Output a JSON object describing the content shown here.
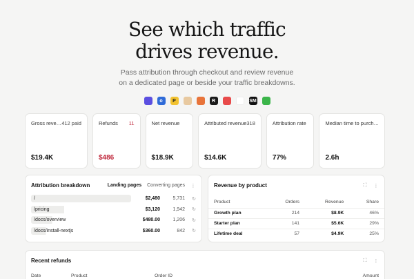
{
  "hero": {
    "title_line1": "See which traffic",
    "title_line2": "drives revenue.",
    "subtitle_line1": "Pass attribution through checkout and review revenue",
    "subtitle_line2": "on a dedicated page or beside your traffic breakdowns."
  },
  "logos": [
    {
      "name": "brand-logo-1",
      "glyph": "",
      "color": "#5b4fe0"
    },
    {
      "name": "brand-logo-2",
      "glyph": "o",
      "color": "#2f6bd8"
    },
    {
      "name": "brand-logo-3",
      "glyph": "P",
      "color": "#f2c230"
    },
    {
      "name": "brand-logo-4",
      "glyph": "",
      "color": "#e8c9a0"
    },
    {
      "name": "brand-logo-5",
      "glyph": "",
      "color": "#e8743a"
    },
    {
      "name": "brand-logo-6",
      "glyph": "R",
      "color": "#1a1a1a"
    },
    {
      "name": "brand-logo-7",
      "glyph": "",
      "color": "#e84a4a"
    },
    {
      "name": "brand-logo-8",
      "glyph": "",
      "color": "#ffffff"
    },
    {
      "name": "brand-logo-9",
      "glyph": "SM",
      "color": "#111111"
    },
    {
      "name": "brand-logo-10",
      "glyph": "",
      "color": "#3bb54a"
    }
  ],
  "stats": {
    "gross_revenue": {
      "label": "Gross reve…",
      "count": "412 paid",
      "value": "$19.4K"
    },
    "refunds": {
      "label": "Refunds",
      "count": "11",
      "value": "$486"
    },
    "net_revenue": {
      "label": "Net revenue",
      "count": "",
      "value": "$18.9K"
    },
    "attributed_revenue": {
      "label": "Attributed revenue",
      "count": "318",
      "value": "$14.6K"
    },
    "attribution_rate": {
      "label": "Attribution rate",
      "count": "",
      "value": "77%"
    },
    "median_time": {
      "label": "Median time to purch…",
      "count": "",
      "value": "2.6h"
    }
  },
  "attribution": {
    "title": "Attribution breakdown",
    "tab_landing": "Landing pages",
    "tab_converting": "Converting pages",
    "rows": [
      {
        "path": "/",
        "revenue": "$2,480",
        "orders": "5,731",
        "bar": 1.0
      },
      {
        "path": "/pricing",
        "revenue": "$3,120",
        "orders": "1,942",
        "bar": 0.33
      },
      {
        "path": "/docs/overview",
        "revenue": "$480.00",
        "orders": "1,206",
        "bar": 0.21
      },
      {
        "path": "/docs/install-nextjs",
        "revenue": "$360.00",
        "orders": "842",
        "bar": 0.15
      }
    ]
  },
  "revenue_by_product": {
    "title": "Revenue by product",
    "columns": {
      "product": "Product",
      "orders": "Orders",
      "revenue": "Revenue",
      "share": "Share"
    },
    "rows": [
      {
        "product": "Growth plan",
        "orders": "214",
        "revenue": "$8.9K",
        "share": "46%"
      },
      {
        "product": "Starter plan",
        "orders": "141",
        "revenue": "$5.6K",
        "share": "29%"
      },
      {
        "product": "Lifetime deal",
        "orders": "57",
        "revenue": "$4.9K",
        "share": "25%"
      }
    ]
  },
  "recent_refunds": {
    "title": "Recent refunds",
    "columns": {
      "date": "Date",
      "product": "Product",
      "order_id": "Order ID",
      "amount": "Amount"
    }
  }
}
